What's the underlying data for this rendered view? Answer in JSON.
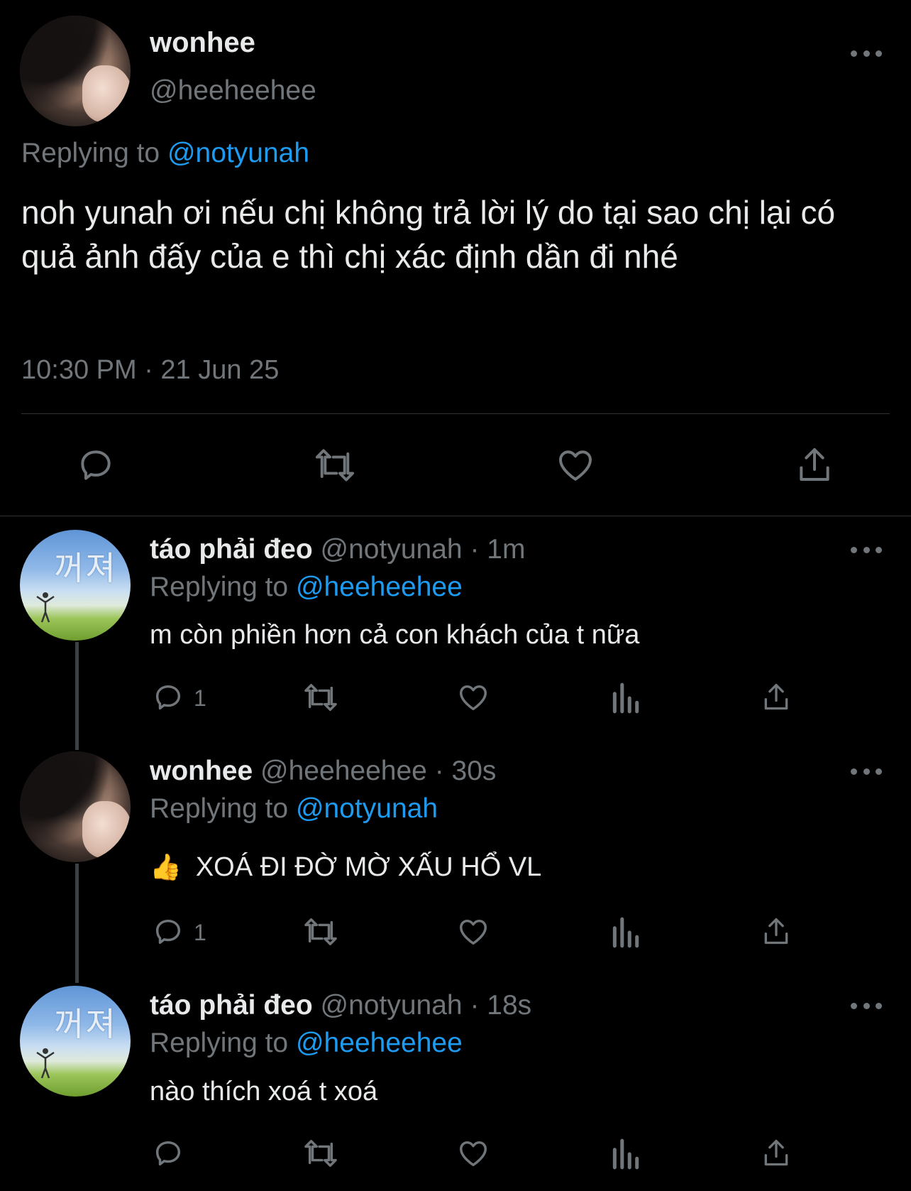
{
  "main_tweet": {
    "name": "wonhee",
    "handle": "@heeheehee",
    "replying_prefix": "Replying to",
    "replying_to": "@notyunah",
    "text": "noh yunah ơi nếu chị không trả lời lý do tại sao chị lại có quả ảnh đấy của e thì chị xác định dần đi nhé",
    "timestamp": "10:30 PM · 21 Jun 25"
  },
  "replies": [
    {
      "name": "táo phải đeo",
      "handle": "@notyunah",
      "time": "· 1m",
      "replying_prefix": "Replying to",
      "replying_to": "@heeheehee",
      "text": "m còn phiền hơn cả con khách của t nữa",
      "reply_count": "1"
    },
    {
      "name": "wonhee",
      "handle": "@heeheehee",
      "time": "· 30s",
      "replying_prefix": "Replying to",
      "replying_to": "@notyunah",
      "emoji": "👍",
      "text": "XOÁ ĐI ĐỜ MỜ XẤU HỔ VL",
      "reply_count": "1"
    },
    {
      "name": "táo phải đeo",
      "handle": "@notyunah",
      "time": "· 18s",
      "replying_prefix": "Replying to",
      "replying_to": "@heeheehee",
      "text": "nào thích xoá t xoá",
      "reply_count": ""
    }
  ],
  "avatar_text": "꺼져",
  "colors": {
    "background": "#000000",
    "text": "#e7e9ea",
    "secondary": "#71767b",
    "link": "#1d9bf0",
    "divider": "#2f3336"
  }
}
